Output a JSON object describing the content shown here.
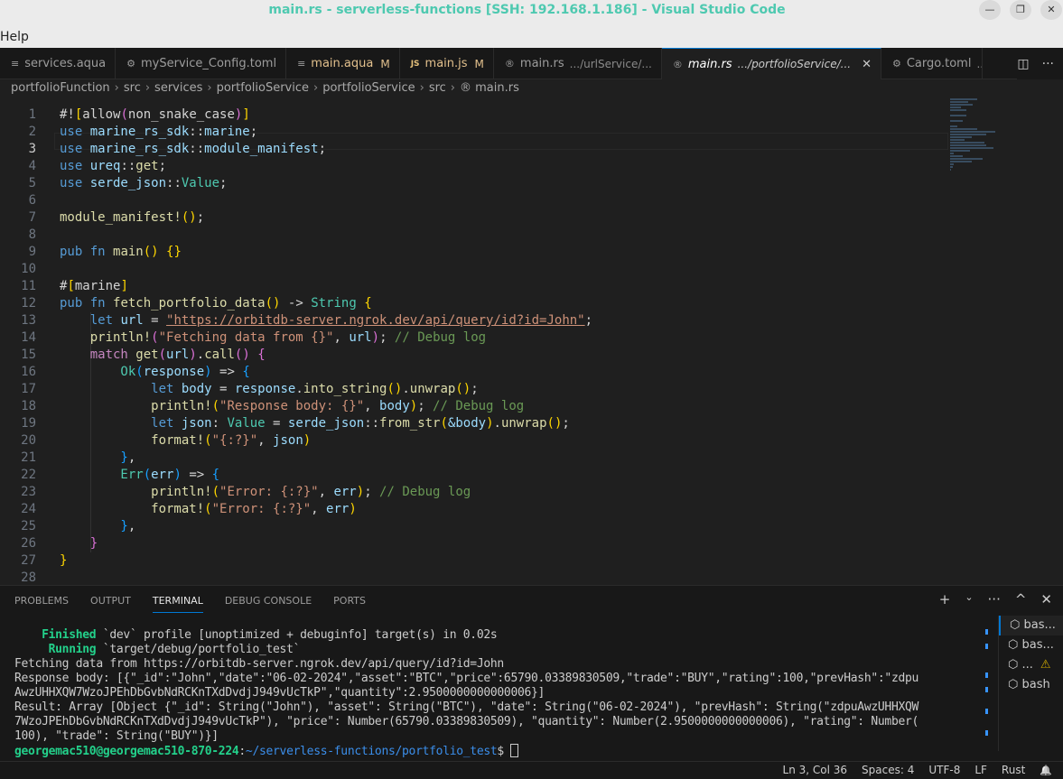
{
  "window": {
    "title": "main.rs - serverless-functions [SSH: 192.168.1.186] - Visual Studio Code",
    "minimize": "—",
    "restore": "❐",
    "close": "✕"
  },
  "menu": {
    "help": "Help"
  },
  "tabs": [
    {
      "label": "services.aqua",
      "icon": "≡",
      "desc": "",
      "mod": ""
    },
    {
      "label": "myService_Config.toml",
      "icon": "⚙",
      "desc": "",
      "mod": ""
    },
    {
      "label": "main.aqua",
      "icon": "≡",
      "desc": "",
      "mod": "M"
    },
    {
      "label": "main.js",
      "icon": "JS",
      "desc": "",
      "mod": "M"
    },
    {
      "label": "main.rs",
      "icon": "®",
      "desc": ".../urlService/...",
      "mod": ""
    },
    {
      "label": "main.rs",
      "icon": "®",
      "desc": ".../portfolioService/...",
      "mod": "",
      "close": "✕"
    },
    {
      "label": "Cargo.toml",
      "icon": "⚙",
      "desc": "..",
      "mod": ""
    }
  ],
  "tab_actions": {
    "split": "◫",
    "more": "···"
  },
  "breadcrumb": [
    "portfolioFunction",
    "src",
    "services",
    "portfolioService",
    "portfolioService",
    "src",
    "main.rs"
  ],
  "editor": {
    "current_line": 3,
    "lines": [
      [
        [
          "#!",
          "p"
        ],
        [
          "[",
          "b1"
        ],
        [
          "allow",
          "p"
        ],
        [
          "(",
          "b2"
        ],
        [
          "non_snake_case",
          "p"
        ],
        [
          ")",
          "b2"
        ],
        [
          "]",
          "b1"
        ]
      ],
      [
        [
          "use ",
          "k"
        ],
        [
          "marine_rs_sdk",
          "v"
        ],
        [
          "::",
          "p"
        ],
        [
          "marine",
          "v"
        ],
        [
          ";",
          "p"
        ]
      ],
      [
        [
          "use ",
          "k"
        ],
        [
          "marine_rs_sdk",
          "v"
        ],
        [
          "::",
          "p"
        ],
        [
          "module_manifest",
          "v"
        ],
        [
          ";",
          "p"
        ]
      ],
      [
        [
          "use ",
          "k"
        ],
        [
          "ureq",
          "v"
        ],
        [
          "::",
          "p"
        ],
        [
          "get",
          "f"
        ],
        [
          ";",
          "p"
        ]
      ],
      [
        [
          "use ",
          "k"
        ],
        [
          "serde_json",
          "v"
        ],
        [
          "::",
          "p"
        ],
        [
          "Value",
          "t"
        ],
        [
          ";",
          "p"
        ]
      ],
      [],
      [
        [
          "module_manifest!",
          "f"
        ],
        [
          "(",
          "b1"
        ],
        [
          ")",
          "b1"
        ],
        [
          ";",
          "p"
        ]
      ],
      [],
      [
        [
          "pub ",
          "k"
        ],
        [
          "fn ",
          "k"
        ],
        [
          "main",
          "f"
        ],
        [
          "() ",
          "b1"
        ],
        [
          "{}",
          "b1"
        ]
      ],
      [],
      [
        [
          "#",
          "p"
        ],
        [
          "[",
          "b1"
        ],
        [
          "marine",
          "p"
        ],
        [
          "]",
          "b1"
        ]
      ],
      [
        [
          "pub ",
          "k"
        ],
        [
          "fn ",
          "k"
        ],
        [
          "fetch_portfolio_data",
          "f"
        ],
        [
          "() ",
          "b1"
        ],
        [
          "-> ",
          "p"
        ],
        [
          "String ",
          "t"
        ],
        [
          "{",
          "b1"
        ]
      ],
      [
        [
          "    let ",
          "k"
        ],
        [
          "url",
          "v"
        ],
        [
          " = ",
          "p"
        ],
        [
          "\"https://orbitdb-server.ngrok.dev/api/query/id?id=John\"",
          "s u"
        ],
        [
          ";",
          "p"
        ]
      ],
      [
        [
          "    println!",
          "f"
        ],
        [
          "(",
          "b2"
        ],
        [
          "\"Fetching data from {}\"",
          "s"
        ],
        [
          ", ",
          "p"
        ],
        [
          "url",
          "v"
        ],
        [
          ")",
          "b2"
        ],
        [
          "; ",
          "p"
        ],
        [
          "// Debug log",
          "m"
        ]
      ],
      [
        [
          "    match ",
          "c"
        ],
        [
          "get",
          "f"
        ],
        [
          "(",
          "b2"
        ],
        [
          "url",
          "v"
        ],
        [
          ")",
          "b2"
        ],
        [
          ".",
          "p"
        ],
        [
          "call",
          "f"
        ],
        [
          "()",
          "b2"
        ],
        [
          " {",
          "b2"
        ]
      ],
      [
        [
          "        Ok",
          "t"
        ],
        [
          "(",
          "b3"
        ],
        [
          "response",
          "v"
        ],
        [
          ")",
          "b3"
        ],
        [
          " => ",
          "p"
        ],
        [
          "{",
          "b3"
        ]
      ],
      [
        [
          "            let ",
          "k"
        ],
        [
          "body",
          "v"
        ],
        [
          " = ",
          "p"
        ],
        [
          "response",
          "v"
        ],
        [
          ".",
          "p"
        ],
        [
          "into_string",
          "f"
        ],
        [
          "()",
          "b1"
        ],
        [
          ".",
          "p"
        ],
        [
          "unwrap",
          "f"
        ],
        [
          "()",
          "b1"
        ],
        [
          ";",
          "p"
        ]
      ],
      [
        [
          "            println!",
          "f"
        ],
        [
          "(",
          "b1"
        ],
        [
          "\"Response body: {}\"",
          "s"
        ],
        [
          ", ",
          "p"
        ],
        [
          "body",
          "v"
        ],
        [
          ")",
          "b1"
        ],
        [
          "; ",
          "p"
        ],
        [
          "// Debug log",
          "m"
        ]
      ],
      [
        [
          "            let ",
          "k"
        ],
        [
          "json",
          "v"
        ],
        [
          ": ",
          "p"
        ],
        [
          "Value",
          "t"
        ],
        [
          " = ",
          "p"
        ],
        [
          "serde_json",
          "v"
        ],
        [
          "::",
          "p"
        ],
        [
          "from_str",
          "f"
        ],
        [
          "(",
          "b1"
        ],
        [
          "&body",
          "v"
        ],
        [
          ")",
          "b1"
        ],
        [
          ".",
          "p"
        ],
        [
          "unwrap",
          "f"
        ],
        [
          "()",
          "b1"
        ],
        [
          ";",
          "p"
        ]
      ],
      [
        [
          "            format!",
          "f"
        ],
        [
          "(",
          "b1"
        ],
        [
          "\"{:?}\"",
          "s"
        ],
        [
          ", ",
          "p"
        ],
        [
          "json",
          "v"
        ],
        [
          ")",
          "b1"
        ]
      ],
      [
        [
          "        }",
          "b3"
        ],
        [
          ",",
          "p"
        ]
      ],
      [
        [
          "        Err",
          "t"
        ],
        [
          "(",
          "b3"
        ],
        [
          "err",
          "v"
        ],
        [
          ")",
          "b3"
        ],
        [
          " => ",
          "p"
        ],
        [
          "{",
          "b3"
        ]
      ],
      [
        [
          "            println!",
          "f"
        ],
        [
          "(",
          "b1"
        ],
        [
          "\"Error: {:?}\"",
          "s"
        ],
        [
          ", ",
          "p"
        ],
        [
          "err",
          "v"
        ],
        [
          ")",
          "b1"
        ],
        [
          "; ",
          "p"
        ],
        [
          "// Debug log",
          "m"
        ]
      ],
      [
        [
          "            format!",
          "f"
        ],
        [
          "(",
          "b1"
        ],
        [
          "\"Error: {:?}\"",
          "s"
        ],
        [
          ", ",
          "p"
        ],
        [
          "err",
          "v"
        ],
        [
          ")",
          "b1"
        ]
      ],
      [
        [
          "        }",
          "b3"
        ],
        [
          ",",
          "p"
        ]
      ],
      [
        [
          "    }",
          "b2"
        ]
      ],
      [
        [
          "}",
          "b1"
        ]
      ],
      []
    ]
  },
  "panel": {
    "tabs": [
      "PROBLEMS",
      "OUTPUT",
      "TERMINAL",
      "DEBUG CONSOLE",
      "PORTS"
    ],
    "active_tab": "TERMINAL",
    "actions": {
      "add": "+",
      "dropdown": "⌄",
      "more": "···",
      "maximize": "^",
      "close": "✕"
    }
  },
  "terminal": {
    "lines": [
      [
        [
          "    Finished",
          "g"
        ],
        [
          " `dev` profile [unoptimized + debuginfo] target(s) in 0.02s",
          ""
        ]
      ],
      [
        [
          "     Running",
          "g"
        ],
        [
          " `target/debug/portfolio_test`",
          ""
        ]
      ],
      [
        [
          "Fetching data from https://orbitdb-server.ngrok.dev/api/query/id?id=John",
          ""
        ]
      ],
      [
        [
          "Response body: [{\"_id\":\"John\",\"date\":\"06-02-2024\",\"asset\":\"BTC\",\"price\":65790.03389830509,\"trade\":\"BUY\",\"rating\":100,\"prevHash\":\"zdpu",
          ""
        ]
      ],
      [
        [
          "AwzUHHXQW7WzoJPEhDbGvbNdRCKnTXdDvdjJ949vUcTkP\",\"quantity\":2.9500000000000006}]",
          ""
        ]
      ],
      [
        [
          "Result: Array [Object {\"_id\": String(\"John\"), \"asset\": String(\"BTC\"), \"date\": String(\"06-02-2024\"), \"prevHash\": String(\"zdpuAwzUHHXQW",
          ""
        ]
      ],
      [
        [
          "7WzoJPEhDbGvbNdRCKnTXdDvdjJ949vUcTkP\"), \"price\": Number(65790.03389830509), \"quantity\": Number(2.9500000000000006), \"rating\": Number(",
          ""
        ]
      ],
      [
        [
          "100), \"trade\": String(\"BUY\")}]",
          ""
        ]
      ],
      [
        [
          "georgemac510@georgemac510-870-224",
          "pg"
        ],
        [
          ":",
          ""
        ],
        [
          "~/serverless-functions/portfolio_test",
          "pb"
        ],
        [
          "$ ",
          ""
        ]
      ]
    ],
    "instances": [
      {
        "label": "bas...",
        "warn": ""
      },
      {
        "label": "bas...",
        "warn": ""
      },
      {
        "label": "...",
        "warn": "⚠"
      },
      {
        "label": "bash",
        "warn": ""
      }
    ]
  },
  "status": {
    "position": "Ln 3, Col 36",
    "spaces": "Spaces: 4",
    "encoding": "UTF-8",
    "eol": "LF",
    "language": "Rust",
    "bell": "🔔"
  }
}
